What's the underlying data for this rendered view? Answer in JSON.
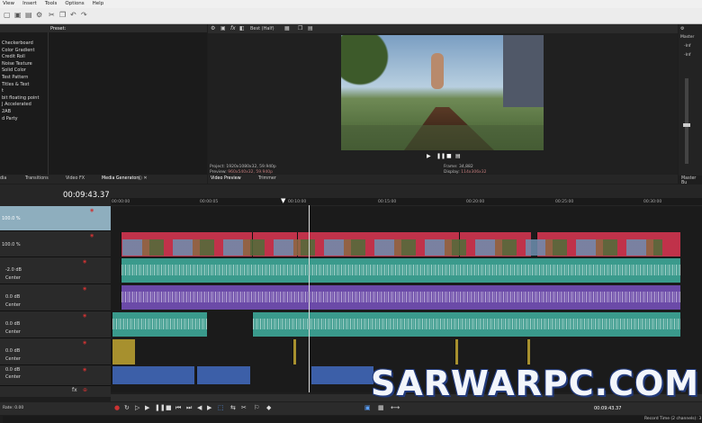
{
  "menu": {
    "items": [
      "View",
      "Insert",
      "Tools",
      "Options",
      "Help"
    ]
  },
  "media_panel": {
    "presets_label": "Preset:",
    "items": [
      "Checkerboard",
      "Color Gradient",
      "Credit Roll",
      "Noise Texture",
      "Solid Color",
      "Test Pattern",
      "Titles & Text",
      "t",
      "bit floating point",
      "J Accelerated",
      "2AB",
      "d Party"
    ],
    "tabs": [
      "dia",
      "Transitions",
      "Video FX",
      "Media Generators"
    ]
  },
  "preview": {
    "quality": "Best (Half)",
    "project_label": "Project:",
    "project_value": "1920x1080x32, 59.940p",
    "preview_label": "Preview:",
    "preview_value": "960x540x32, 59.940p",
    "frame_label": "Frame:",
    "frame_value": "34,882",
    "display_label": "Display:",
    "display_value": "114x306x32",
    "tabs": [
      "Video Preview",
      "Trimmer"
    ]
  },
  "master": {
    "label": "Master",
    "val1": "-Inf",
    "val2": "-Inf",
    "bus_tab": "Master Bu"
  },
  "timeline": {
    "timecode": "00:09:43.37",
    "ruler": [
      "00:00:00",
      "00:00:05",
      "00:10:00",
      "00:15:00",
      "00:20:00",
      "00:25:00",
      "00:30:00"
    ],
    "tracks": [
      {
        "type": "video",
        "level": "100.0 %"
      },
      {
        "type": "video",
        "level": "100.0 %"
      },
      {
        "type": "audio",
        "vol": "-2.0 dB",
        "pan": "Center"
      },
      {
        "type": "audio",
        "vol": "0.0 dB",
        "pan": "Center"
      },
      {
        "type": "audio",
        "vol": "0.0 dB",
        "pan": "Center"
      },
      {
        "type": "audio",
        "vol": "0.0 dB",
        "pan": "Center"
      },
      {
        "type": "audio",
        "vol": "0.0 dB",
        "pan": "Center"
      }
    ],
    "status_rate": "Rate: 0.00",
    "bottom_timecode": "00:09:43.37",
    "record_time": "Record Time (2 channels): 3"
  },
  "watermark": "SARWARPC.COM",
  "colors": {
    "video_clip": "#c0324a",
    "audio_teal": "#3a9a8c",
    "audio_purple": "#6b4aa8",
    "audio_yellow": "#a7902e",
    "audio_blue": "#3c5fa8",
    "background": "#1e1e1e"
  }
}
